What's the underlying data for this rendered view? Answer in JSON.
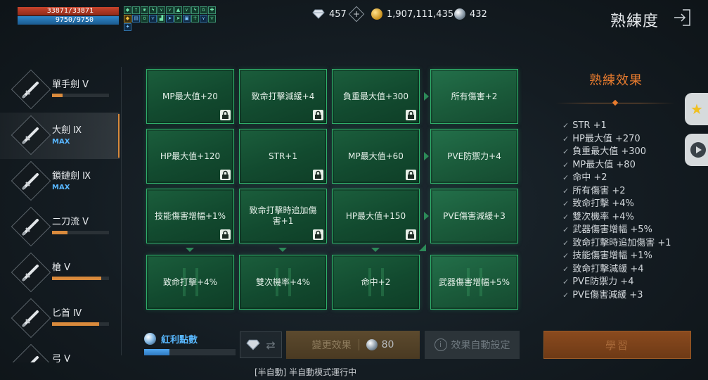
{
  "player": {
    "hp": "33871/33871",
    "mp": "9750/9750"
  },
  "buff_icons": [
    "shield",
    "sword",
    "leaf",
    "bolt",
    "wing",
    "wing",
    "flame",
    "wing",
    "bolt",
    "flask",
    "cross",
    "shield",
    "chest",
    "potion",
    "wing",
    "shoe",
    "arrow",
    "arrow",
    "box",
    "person",
    "wing",
    "wing",
    "crest"
  ],
  "currency": {
    "diamonds": "457",
    "gold": "1,907,111,435",
    "orbs": "432"
  },
  "page": {
    "title": "熟練度"
  },
  "weapons": [
    {
      "name": "單手劍 Ⅴ",
      "max": "",
      "progress": 0.18,
      "selected": false,
      "icon": "sword-icon"
    },
    {
      "name": "大劍 Ⅸ",
      "max": "MAX",
      "progress": null,
      "selected": true,
      "icon": "greatsword-icon"
    },
    {
      "name": "鎖鏈劍 Ⅸ",
      "max": "MAX",
      "progress": null,
      "selected": false,
      "icon": "chainsword-icon"
    },
    {
      "name": "二刀流 Ⅴ",
      "max": "",
      "progress": 0.27,
      "selected": false,
      "icon": "dual-blades-icon"
    },
    {
      "name": "槍 Ⅴ",
      "max": "",
      "progress": 0.86,
      "selected": false,
      "icon": "spear-icon"
    },
    {
      "name": "匕首 Ⅳ",
      "max": "",
      "progress": 0.83,
      "selected": false,
      "icon": "dagger-icon"
    },
    {
      "name": "弓 Ⅴ",
      "max": "",
      "progress": null,
      "selected": false,
      "icon": "bow-icon"
    }
  ],
  "grid": {
    "rows": [
      [
        "MP最大值+20",
        "致命打擊減緩+4",
        "負重最大值+300",
        "所有傷害+2"
      ],
      [
        "HP最大值+120",
        "STR+1",
        "MP最大值+60",
        "PVE防禦力+4"
      ],
      [
        "技能傷害增幅+1%",
        "致命打擊時追加傷害+1",
        "HP最大值+150",
        "PVE傷害減緩+3"
      ],
      [
        "致命打擊+4%",
        "雙次機率+4%",
        "命中+2",
        "武器傷害增幅+5%"
      ]
    ]
  },
  "effects": {
    "title": "熟練效果",
    "items": [
      "STR +1",
      "HP最大值 +270",
      "負重最大值 +300",
      "MP最大值 +80",
      "命中 +2",
      "所有傷害 +2",
      "致命打擊 +4%",
      "雙次機率 +4%",
      "武器傷害增幅 +5%",
      "致命打擊時追加傷害 +1",
      "技能傷害增幅 +1%",
      "致命打擊減緩 +4",
      "PVE防禦力 +4",
      "PVE傷害減緩 +3"
    ]
  },
  "bonus": {
    "label": "紅利點數",
    "progress": 0.28
  },
  "buttons": {
    "change": "變更效果",
    "change_cost": "80",
    "auto": "效果自動設定",
    "learn": "學習"
  },
  "status": "[半自動] 半自動模式運行中"
}
